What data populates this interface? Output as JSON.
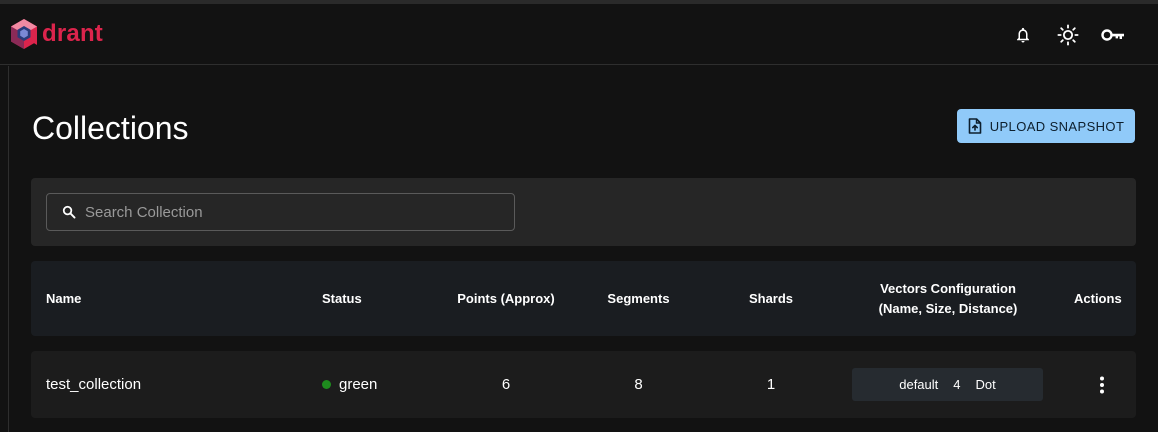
{
  "brand": {
    "logo_text": "drant",
    "accent": "#dc244c"
  },
  "topbar": {
    "icons": [
      "bell-icon",
      "sun-icon",
      "key-icon"
    ]
  },
  "page": {
    "title": "Collections",
    "upload_button_label": "UPLOAD SNAPSHOT",
    "upload_button_color": "#90caf9"
  },
  "search": {
    "placeholder": "Search Collection",
    "value": ""
  },
  "table": {
    "headers": {
      "name": "Name",
      "status": "Status",
      "points": "Points (Approx)",
      "segments": "Segments",
      "shards": "Shards",
      "vectors_line1": "Vectors Configuration",
      "vectors_line2": "(Name, Size, Distance)",
      "actions": "Actions"
    },
    "rows": [
      {
        "name": "test_collection",
        "status": "green",
        "status_color": "#1e8c1e",
        "points": "6",
        "segments": "8",
        "shards": "1",
        "vector_name": "default",
        "vector_size": "4",
        "vector_distance": "Dot"
      }
    ]
  }
}
